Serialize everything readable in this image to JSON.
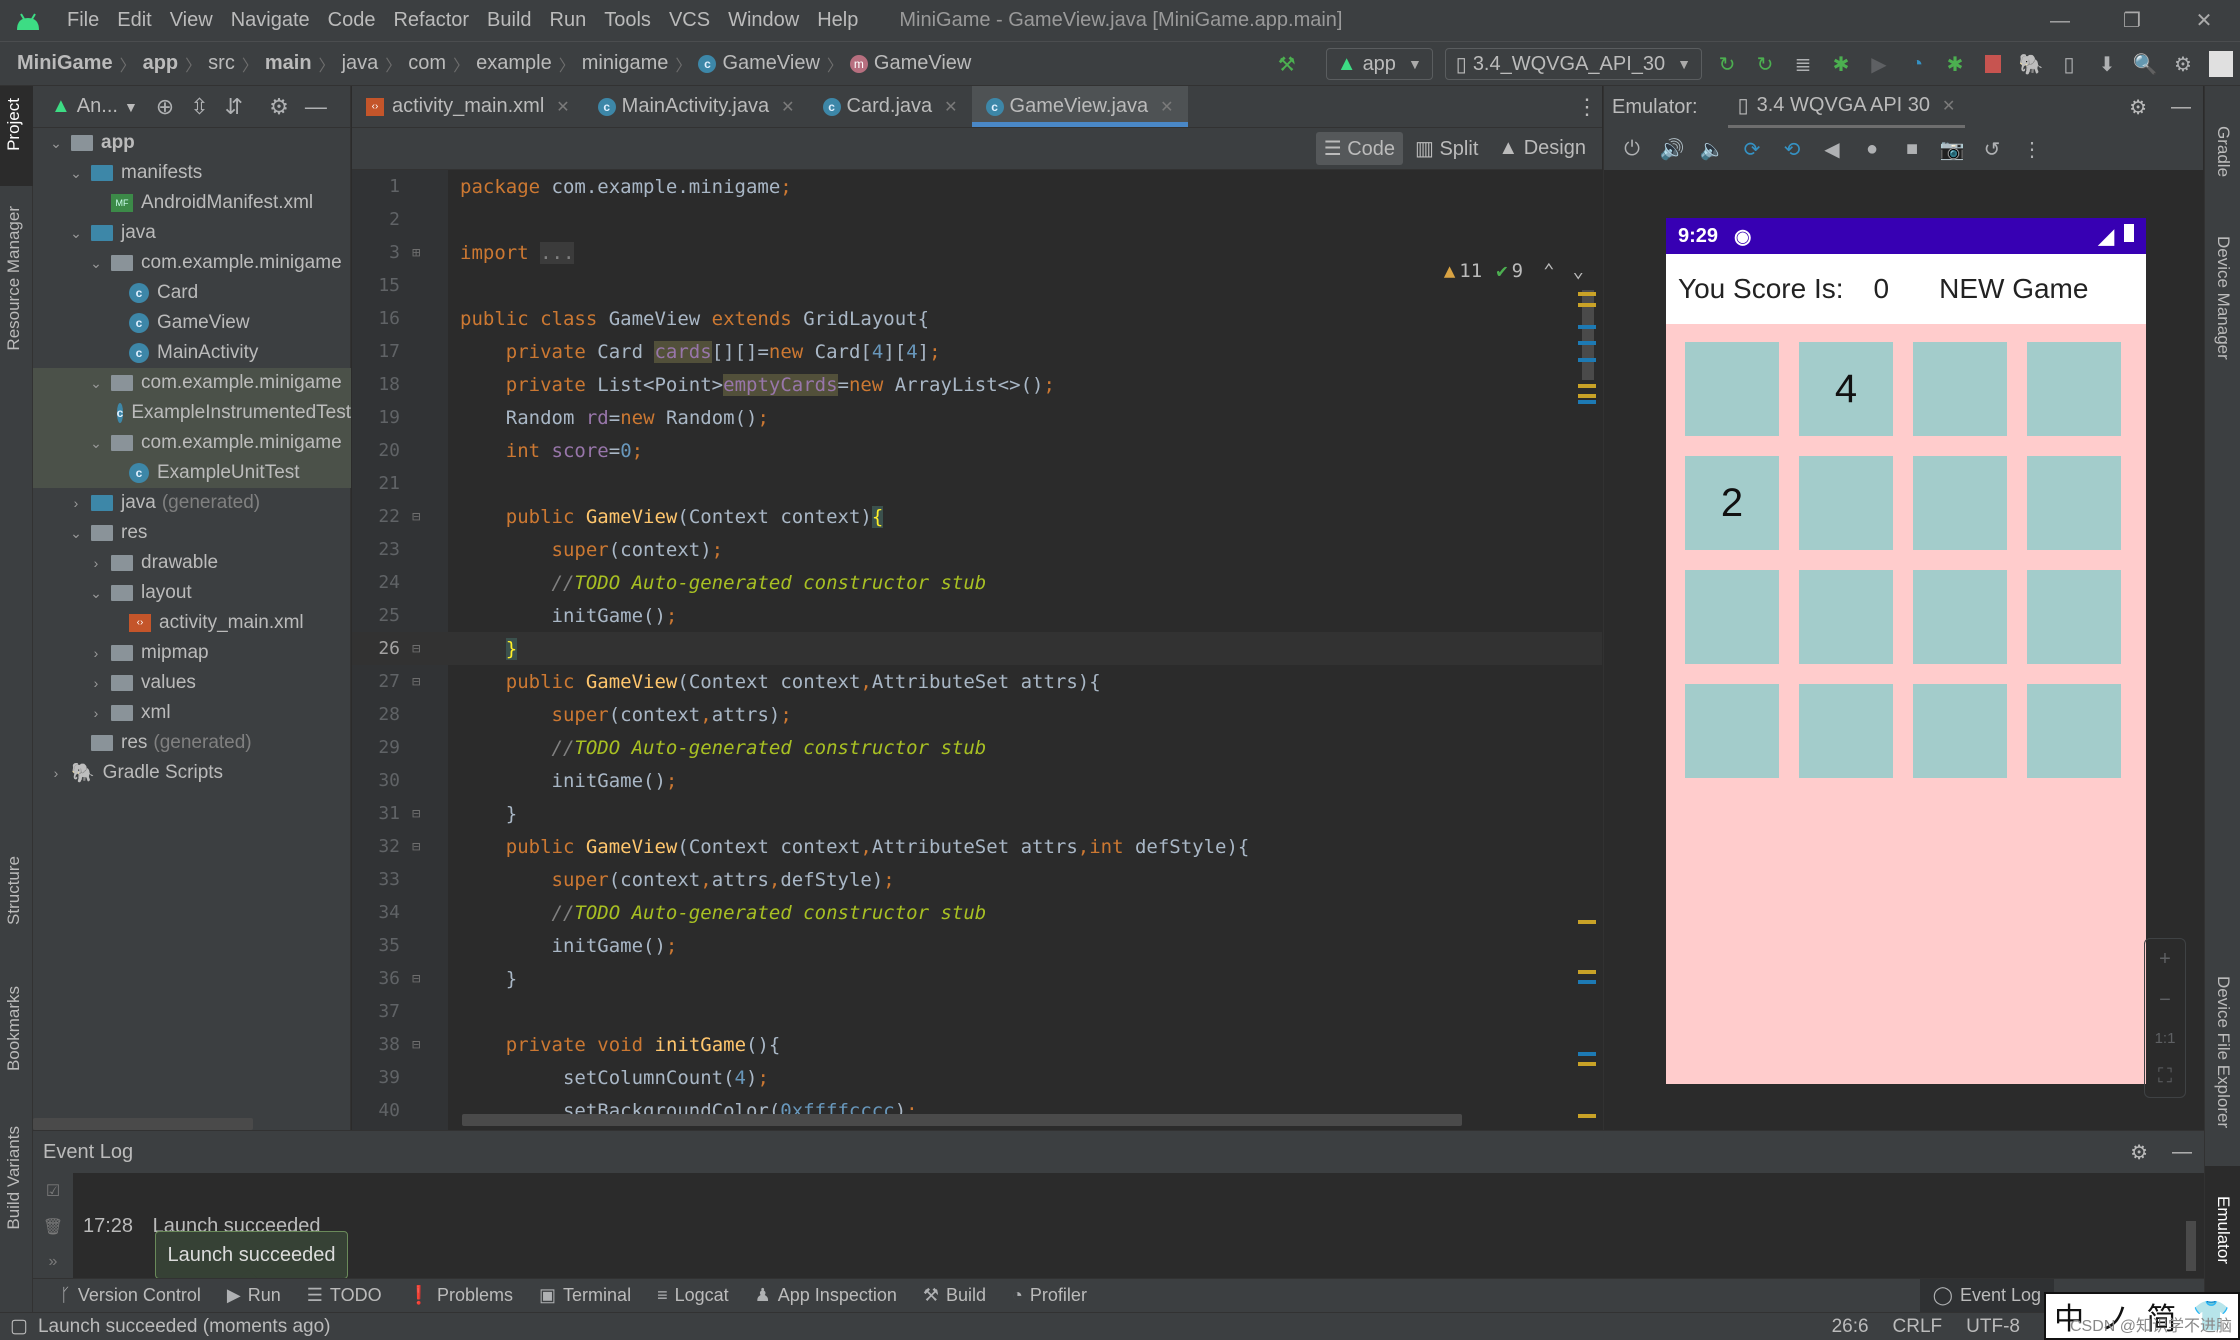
{
  "menubar": {
    "items": [
      "File",
      "Edit",
      "View",
      "Navigate",
      "Code",
      "Refactor",
      "Build",
      "Run",
      "Tools",
      "VCS",
      "Window",
      "Help"
    ],
    "window_title": "MiniGame - GameView.java [MiniGame.app.main]",
    "minimize": "—",
    "maximize": "❐",
    "close": "✕"
  },
  "breadcrumb": {
    "items": [
      "MiniGame",
      "app",
      "src",
      "main",
      "java",
      "com",
      "example",
      "minigame"
    ],
    "class_item": "GameView",
    "method_item": "GameView"
  },
  "toolbar": {
    "run_config": "app",
    "device": "3.4_WQVGA_API_30"
  },
  "project_panel": {
    "view_label": "An...",
    "tree": [
      {
        "label": "app",
        "type": "module"
      },
      {
        "label": "manifests",
        "type": "folder"
      },
      {
        "label": "AndroidManifest.xml",
        "type": "manifest"
      },
      {
        "label": "java",
        "type": "folder"
      },
      {
        "label": "com.example.minigame",
        "type": "package"
      },
      {
        "label": "Card",
        "type": "class"
      },
      {
        "label": "GameView",
        "type": "class"
      },
      {
        "label": "MainActivity",
        "type": "class"
      },
      {
        "label": "com.example.minigame",
        "type": "package"
      },
      {
        "label": "ExampleInstrumentedTest",
        "type": "test"
      },
      {
        "label": "com.example.minigame",
        "type": "package"
      },
      {
        "label": "ExampleUnitTest",
        "type": "test"
      },
      {
        "label": "java",
        "suffix": "(generated)",
        "type": "folder"
      },
      {
        "label": "res",
        "type": "folder"
      },
      {
        "label": "drawable",
        "type": "folder"
      },
      {
        "label": "layout",
        "type": "folder"
      },
      {
        "label": "activity_main.xml",
        "type": "xml"
      },
      {
        "label": "mipmap",
        "type": "folder"
      },
      {
        "label": "values",
        "type": "folder"
      },
      {
        "label": "xml",
        "type": "folder"
      },
      {
        "label": "res",
        "suffix": "(generated)",
        "type": "folder"
      },
      {
        "label": "Gradle Scripts",
        "type": "gradle"
      }
    ]
  },
  "left_tool_tabs": [
    "Project",
    "Resource Manager",
    "Structure",
    "Bookmarks",
    "Build Variants"
  ],
  "right_tool_tabs": [
    "Gradle",
    "Device Manager",
    "Device File Explorer",
    "Emulator"
  ],
  "editor": {
    "tabs": [
      "activity_main.xml",
      "MainActivity.java",
      "Card.java",
      "GameView.java"
    ],
    "active_tab": 3,
    "modes": [
      "Code",
      "Split",
      "Design"
    ],
    "warnings": "11",
    "weak_warnings": "9",
    "line_numbers": [
      "1",
      "2",
      "3",
      "15",
      "16",
      "17",
      "18",
      "19",
      "20",
      "21",
      "22",
      "23",
      "24",
      "25",
      "26",
      "27",
      "28",
      "29",
      "30",
      "31",
      "32",
      "33",
      "34",
      "35",
      "36",
      "37",
      "38",
      "39",
      "40"
    ],
    "current_line": "26"
  },
  "emulator": {
    "label": "Emulator:",
    "device_tab": "3.4 WQVGA API 30",
    "phone": {
      "time": "9:29",
      "score_label": "You Score Is:",
      "score_value": "0",
      "new_game": "NEW Game",
      "grid": [
        "",
        "4",
        "",
        "",
        "2",
        "",
        "",
        "",
        "",
        "",
        "",
        "",
        "",
        "",
        "",
        ""
      ],
      "bg_color": "#ffcccc",
      "card_color": "#a3cccb",
      "status_color": "#3700b3"
    },
    "zoom_controls": [
      "+",
      "−",
      "1:1",
      "⛶"
    ]
  },
  "event_log": {
    "title": "Event Log",
    "time": "17:28",
    "message": "Launch succeeded",
    "tooltip": "Launch succeeded"
  },
  "tool_windows": [
    "Version Control",
    "Run",
    "TODO",
    "Problems",
    "Terminal",
    "Logcat",
    "App Inspection",
    "Build",
    "Profiler"
  ],
  "tool_window_right": "Event Log",
  "statusbar": {
    "message": "Launch succeeded (moments ago)",
    "position": "26:6",
    "line_sep": "CRLF",
    "encoding": "UTF-8"
  },
  "watermark": "CSDN @知识学不进脑"
}
